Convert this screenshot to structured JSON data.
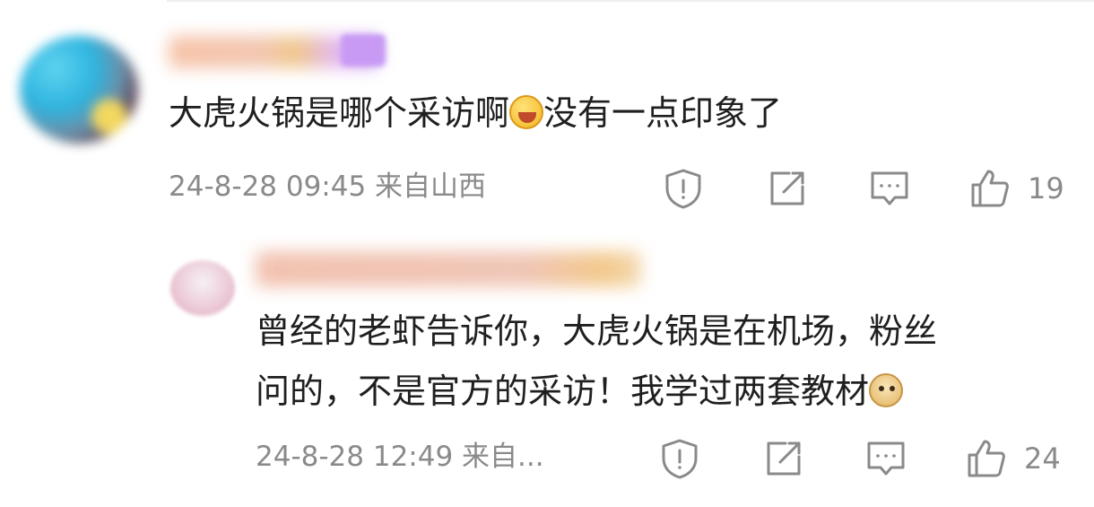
{
  "comment": {
    "text_before": "大虎火锅是哪个采访啊",
    "emoji": "laughing-crying-emoji",
    "text_after": "没有一点印象了",
    "timestamp": "24-8-28 09:45",
    "location": "来自山西",
    "like_count": "19"
  },
  "reply": {
    "line1": "曾经的老虾告诉你，大虎火锅是在机场，粉丝",
    "line2": "问的，不是官方的采访！我学过两套教材",
    "emoji": "doge-emoji",
    "timestamp": "24-8-28 12:49",
    "location": "来自...",
    "like_count": "24"
  },
  "icons": [
    "report-icon",
    "share-icon",
    "reply-icon",
    "like-icon"
  ],
  "colors": {
    "text": "#1f1f1f",
    "meta": "#8a8a8a"
  }
}
